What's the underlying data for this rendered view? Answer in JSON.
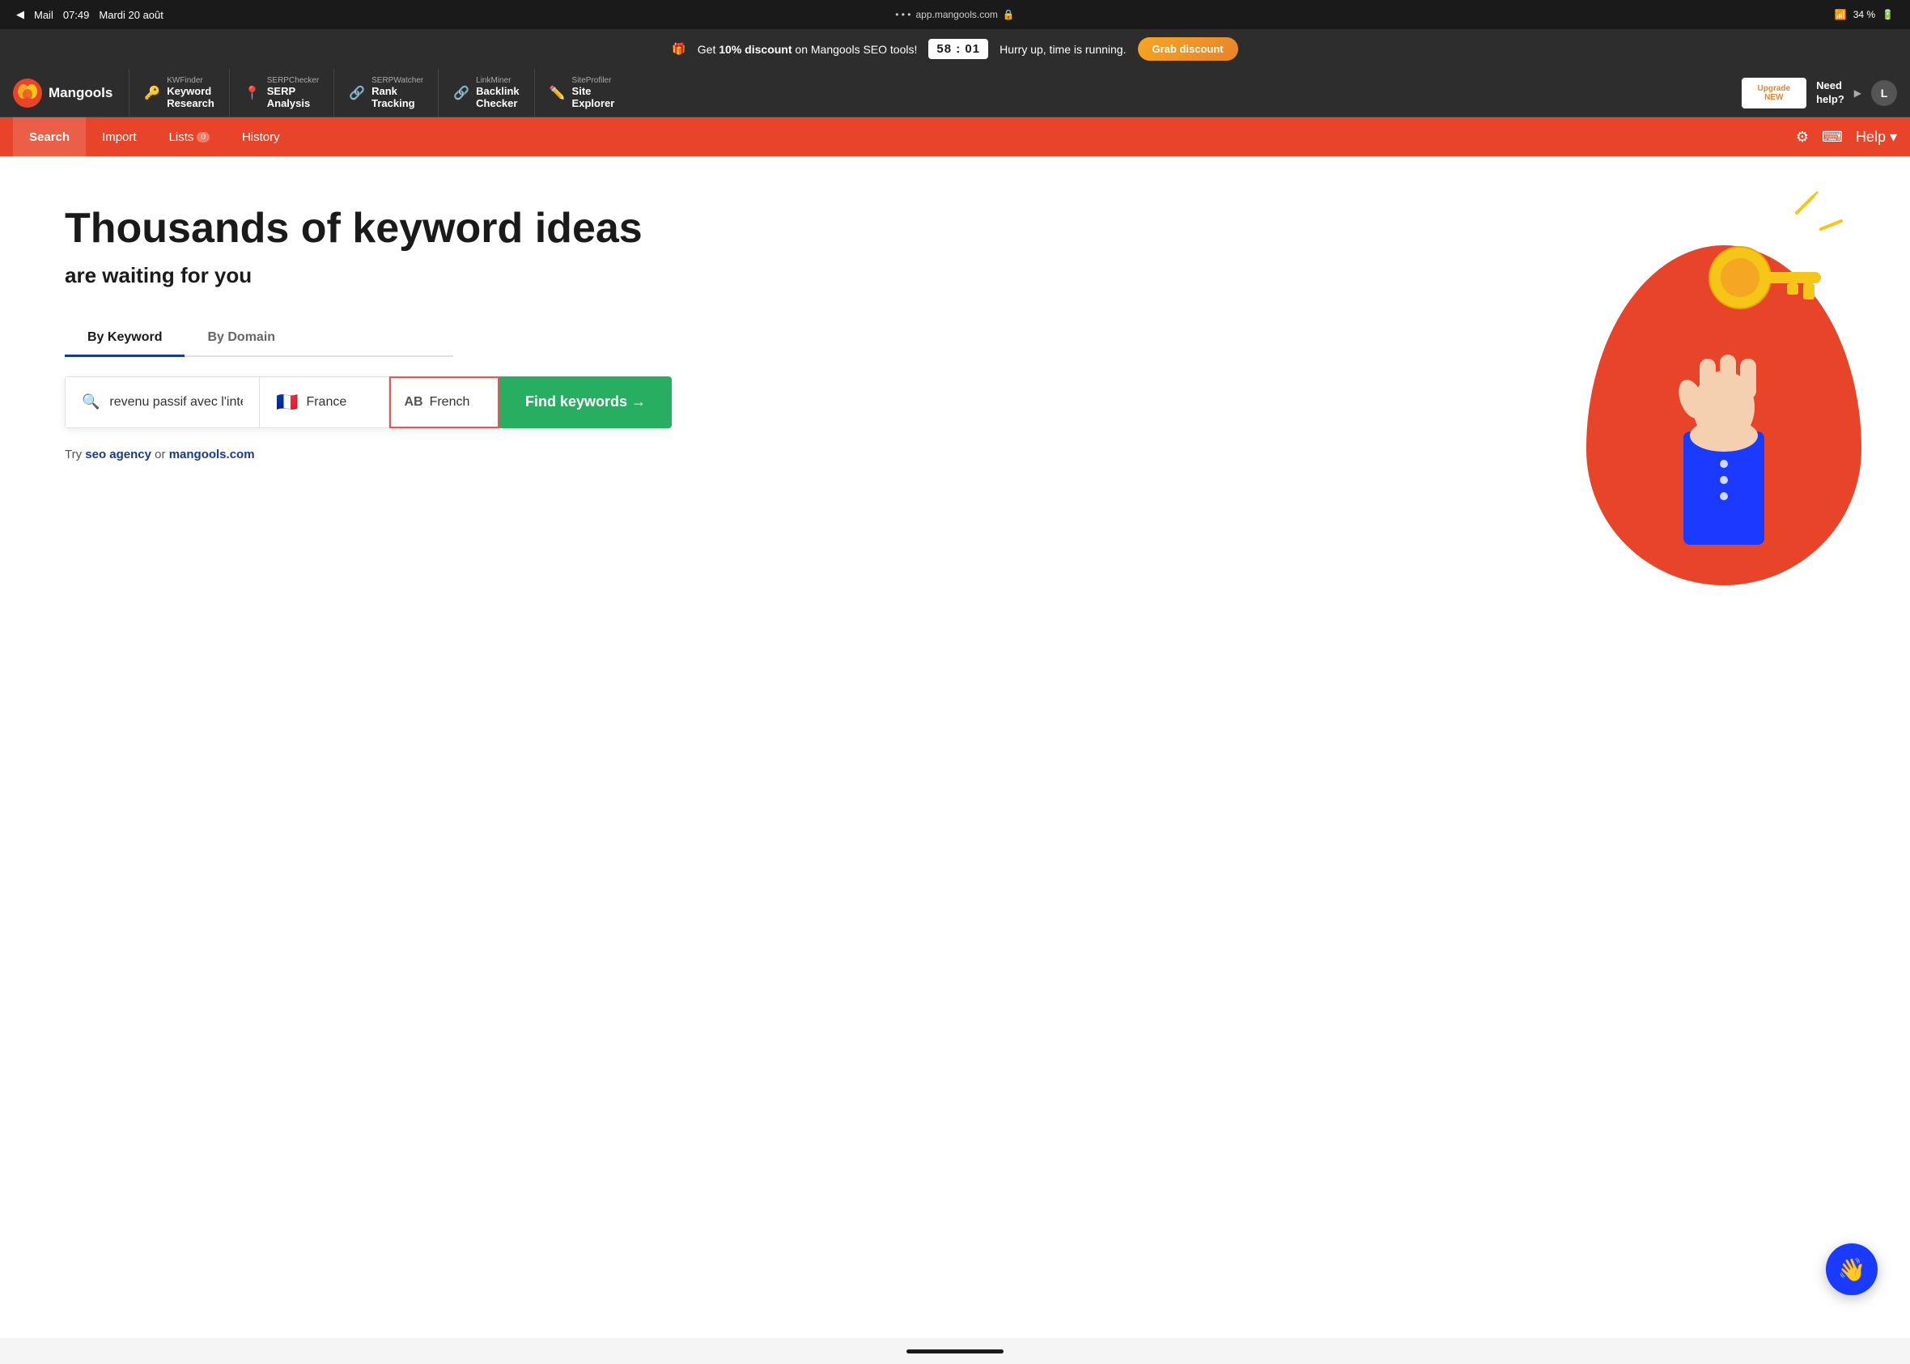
{
  "statusBar": {
    "mail": "Mail",
    "time": "07:49",
    "date": "Mardi 20 août",
    "url": "app.mangools.com",
    "lock": "🔒",
    "wifi": "34 %",
    "battery": "34 %"
  },
  "discountBanner": {
    "giftIcon": "🎁",
    "text1": "Get ",
    "discount": "10% discount",
    "text2": " on Mangools SEO tools!",
    "timer": "58 : 01",
    "hurryText": "Hurry up, time is running.",
    "ctaLabel": "Grab discount"
  },
  "navbar": {
    "logo": "Mangools",
    "tools": [
      {
        "icon": "🔑",
        "category": "KWFinder",
        "name": "Keyword\nResearch"
      },
      {
        "icon": "📍",
        "category": "SERPChecker",
        "name": "SERP\nAnalysis"
      },
      {
        "icon": "🔗",
        "category": "SERPWatcher",
        "name": "Rank\nTracking"
      },
      {
        "icon": "🔗",
        "category": "LinkMiner",
        "name": "Backlink\nChecker"
      },
      {
        "icon": "✏️",
        "category": "SiteProfiler",
        "name": "Site\nExplorer"
      }
    ],
    "upgradeLabel": "Upgrade",
    "upgradeNew": "NEW",
    "needHelp": "Need\nhelp?",
    "avatarLabel": "L"
  },
  "subNav": {
    "items": [
      {
        "label": "Search",
        "active": true
      },
      {
        "label": "Import",
        "active": false
      },
      {
        "label": "Lists",
        "badge": "0",
        "active": false
      },
      {
        "label": "History",
        "active": false
      }
    ]
  },
  "hero": {
    "title": "Thousands of keyword ideas",
    "subtitle": "are waiting for you",
    "tabs": [
      {
        "label": "By Keyword",
        "active": true
      },
      {
        "label": "By Domain",
        "active": false
      }
    ],
    "searchPlaceholder": "revenu passif avec l'intellig",
    "country": "France",
    "language": "French",
    "findButton": "Find keywords →",
    "tryText": "Try ",
    "tryLink1": "seo agency",
    "tryOr": " or ",
    "tryLink2": "mangools.com"
  },
  "chat": {
    "icon": "👋"
  }
}
